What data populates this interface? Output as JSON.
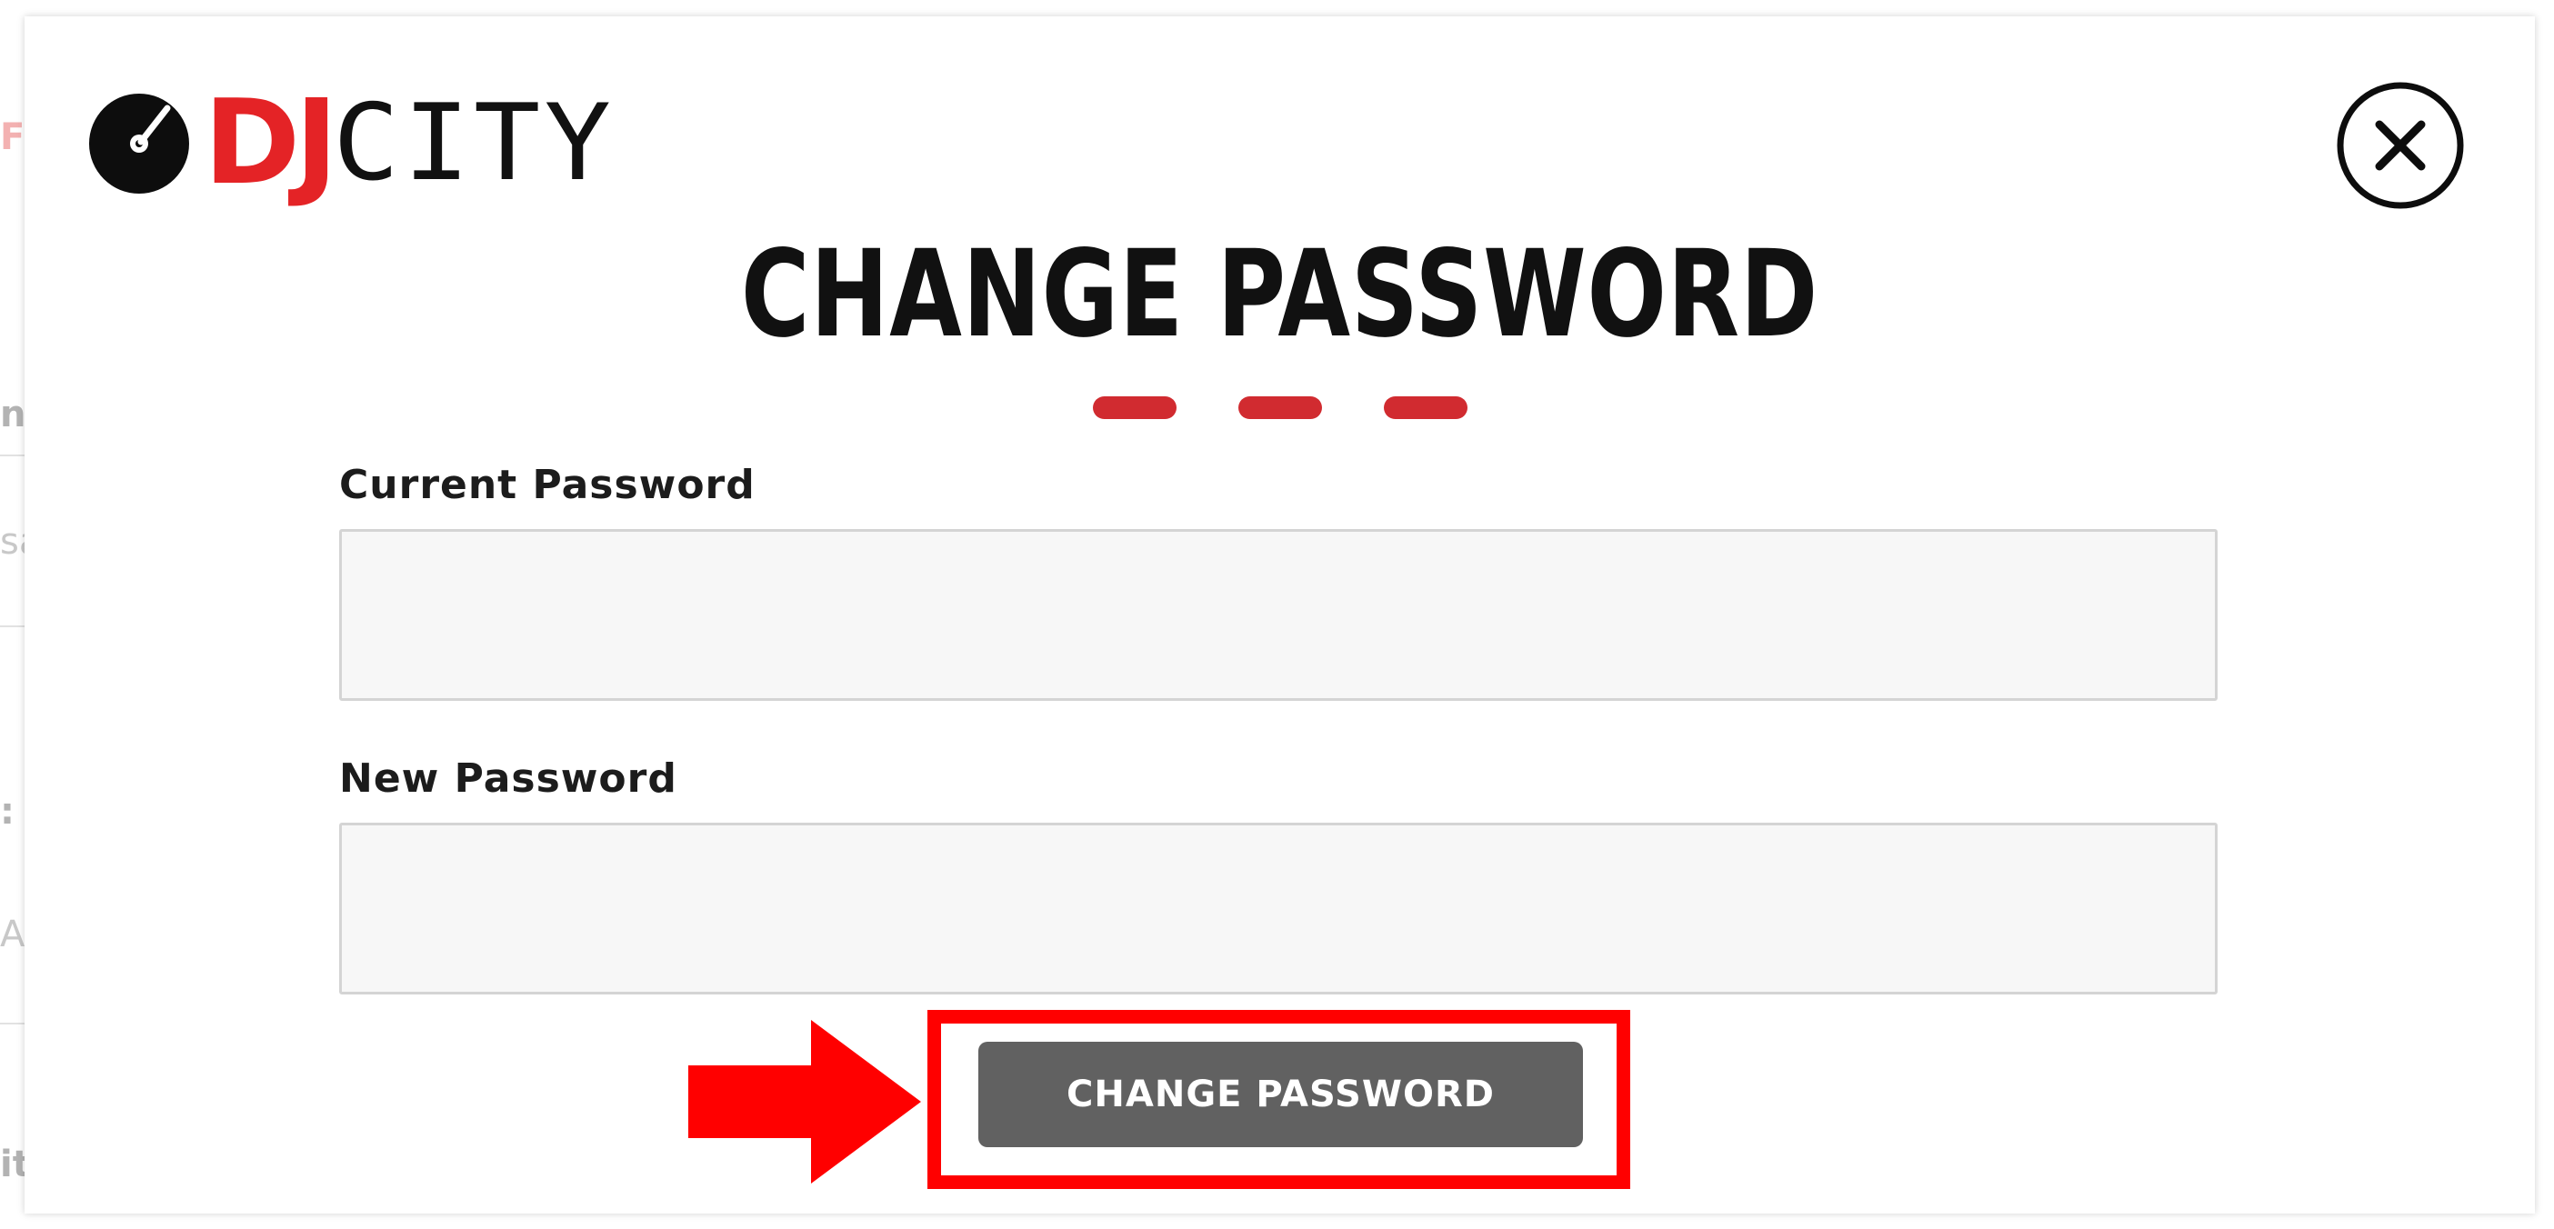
{
  "background_fragments": [
    {
      "text": "F",
      "color": "#f0a0a0"
    },
    {
      "text": "ni",
      "color": "#b3b3b3"
    },
    {
      "text": "sa",
      "color": "#c8c8c8"
    },
    {
      "text": ":",
      "color": "#b3b3b3"
    },
    {
      "text": "AS",
      "color": "#c8c8c8"
    },
    {
      "text": "it",
      "color": "#b3b3b3"
    }
  ],
  "modal": {
    "logo": {
      "dj": "DJ",
      "city": "CITY",
      "dj_color": "#e42326",
      "icon": "vinyl-record-icon"
    },
    "close_icon": "close-icon",
    "title": "CHANGE PASSWORD",
    "divider_color": "#d12b30",
    "fields": [
      {
        "label": "Current Password",
        "value": "",
        "placeholder": ""
      },
      {
        "label": "New Password",
        "value": "",
        "placeholder": ""
      }
    ],
    "submit_button": {
      "label": "CHANGE PASSWORD",
      "bg": "#616161"
    },
    "annotation": {
      "color": "#ff0000",
      "arrow_icon": "arrow-right-icon",
      "box": "highlight-box"
    }
  }
}
